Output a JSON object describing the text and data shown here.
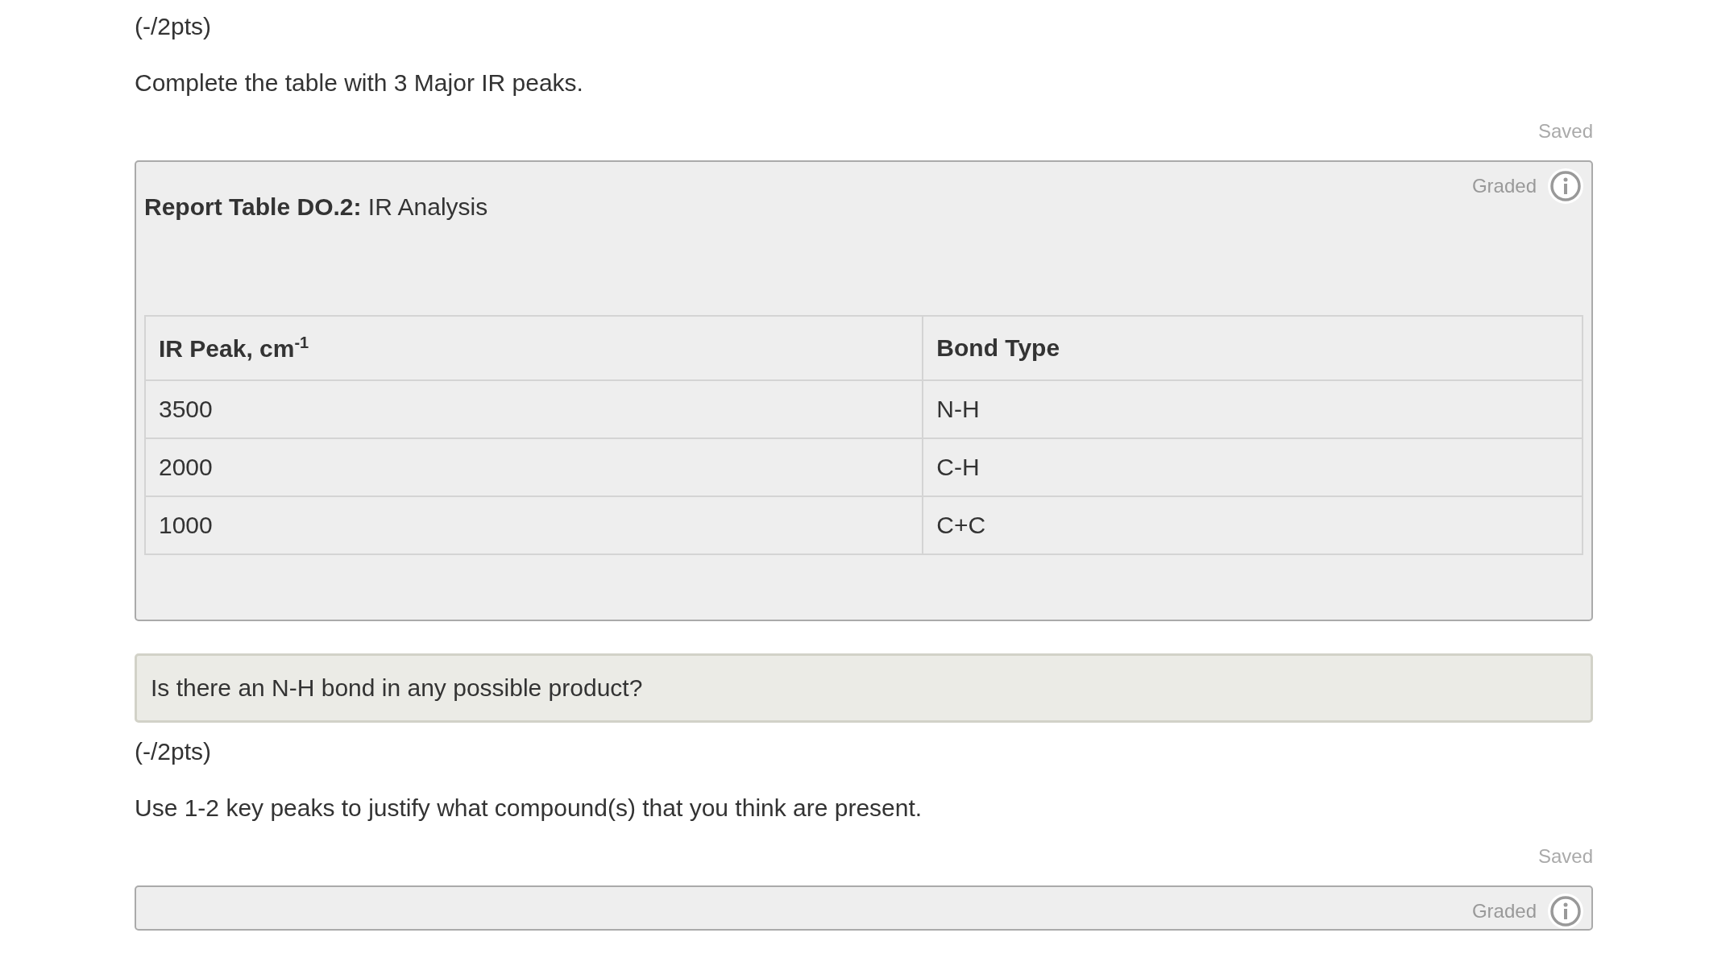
{
  "sections": [
    {
      "kind": "question",
      "points": "(-/2pts)",
      "prompt": "Complete the table with 3 Major IR peaks.",
      "status": "Saved",
      "panel": {
        "grade_label": "Graded",
        "title": "**Report Table DO.2:** IR Analysis",
        "table": {
          "columns": [
            "IR Peak, cm$^{-1}$",
            "Bond Type"
          ],
          "rows": [
            [
              "3500",
              "N-H"
            ],
            [
              "2000",
              "C-H"
            ],
            [
              "1000",
              "C+C"
            ]
          ]
        }
      }
    },
    {
      "kind": "banner",
      "text": "Is there an N-H bond in any possible product?"
    },
    {
      "kind": "question",
      "points": "(-/2pts)",
      "prompt": "Use 1-2 key peaks to justify what compound(s) that you think are present.",
      "status": "Saved",
      "panel": {
        "grade_label": "Graded"
      }
    }
  ]
}
